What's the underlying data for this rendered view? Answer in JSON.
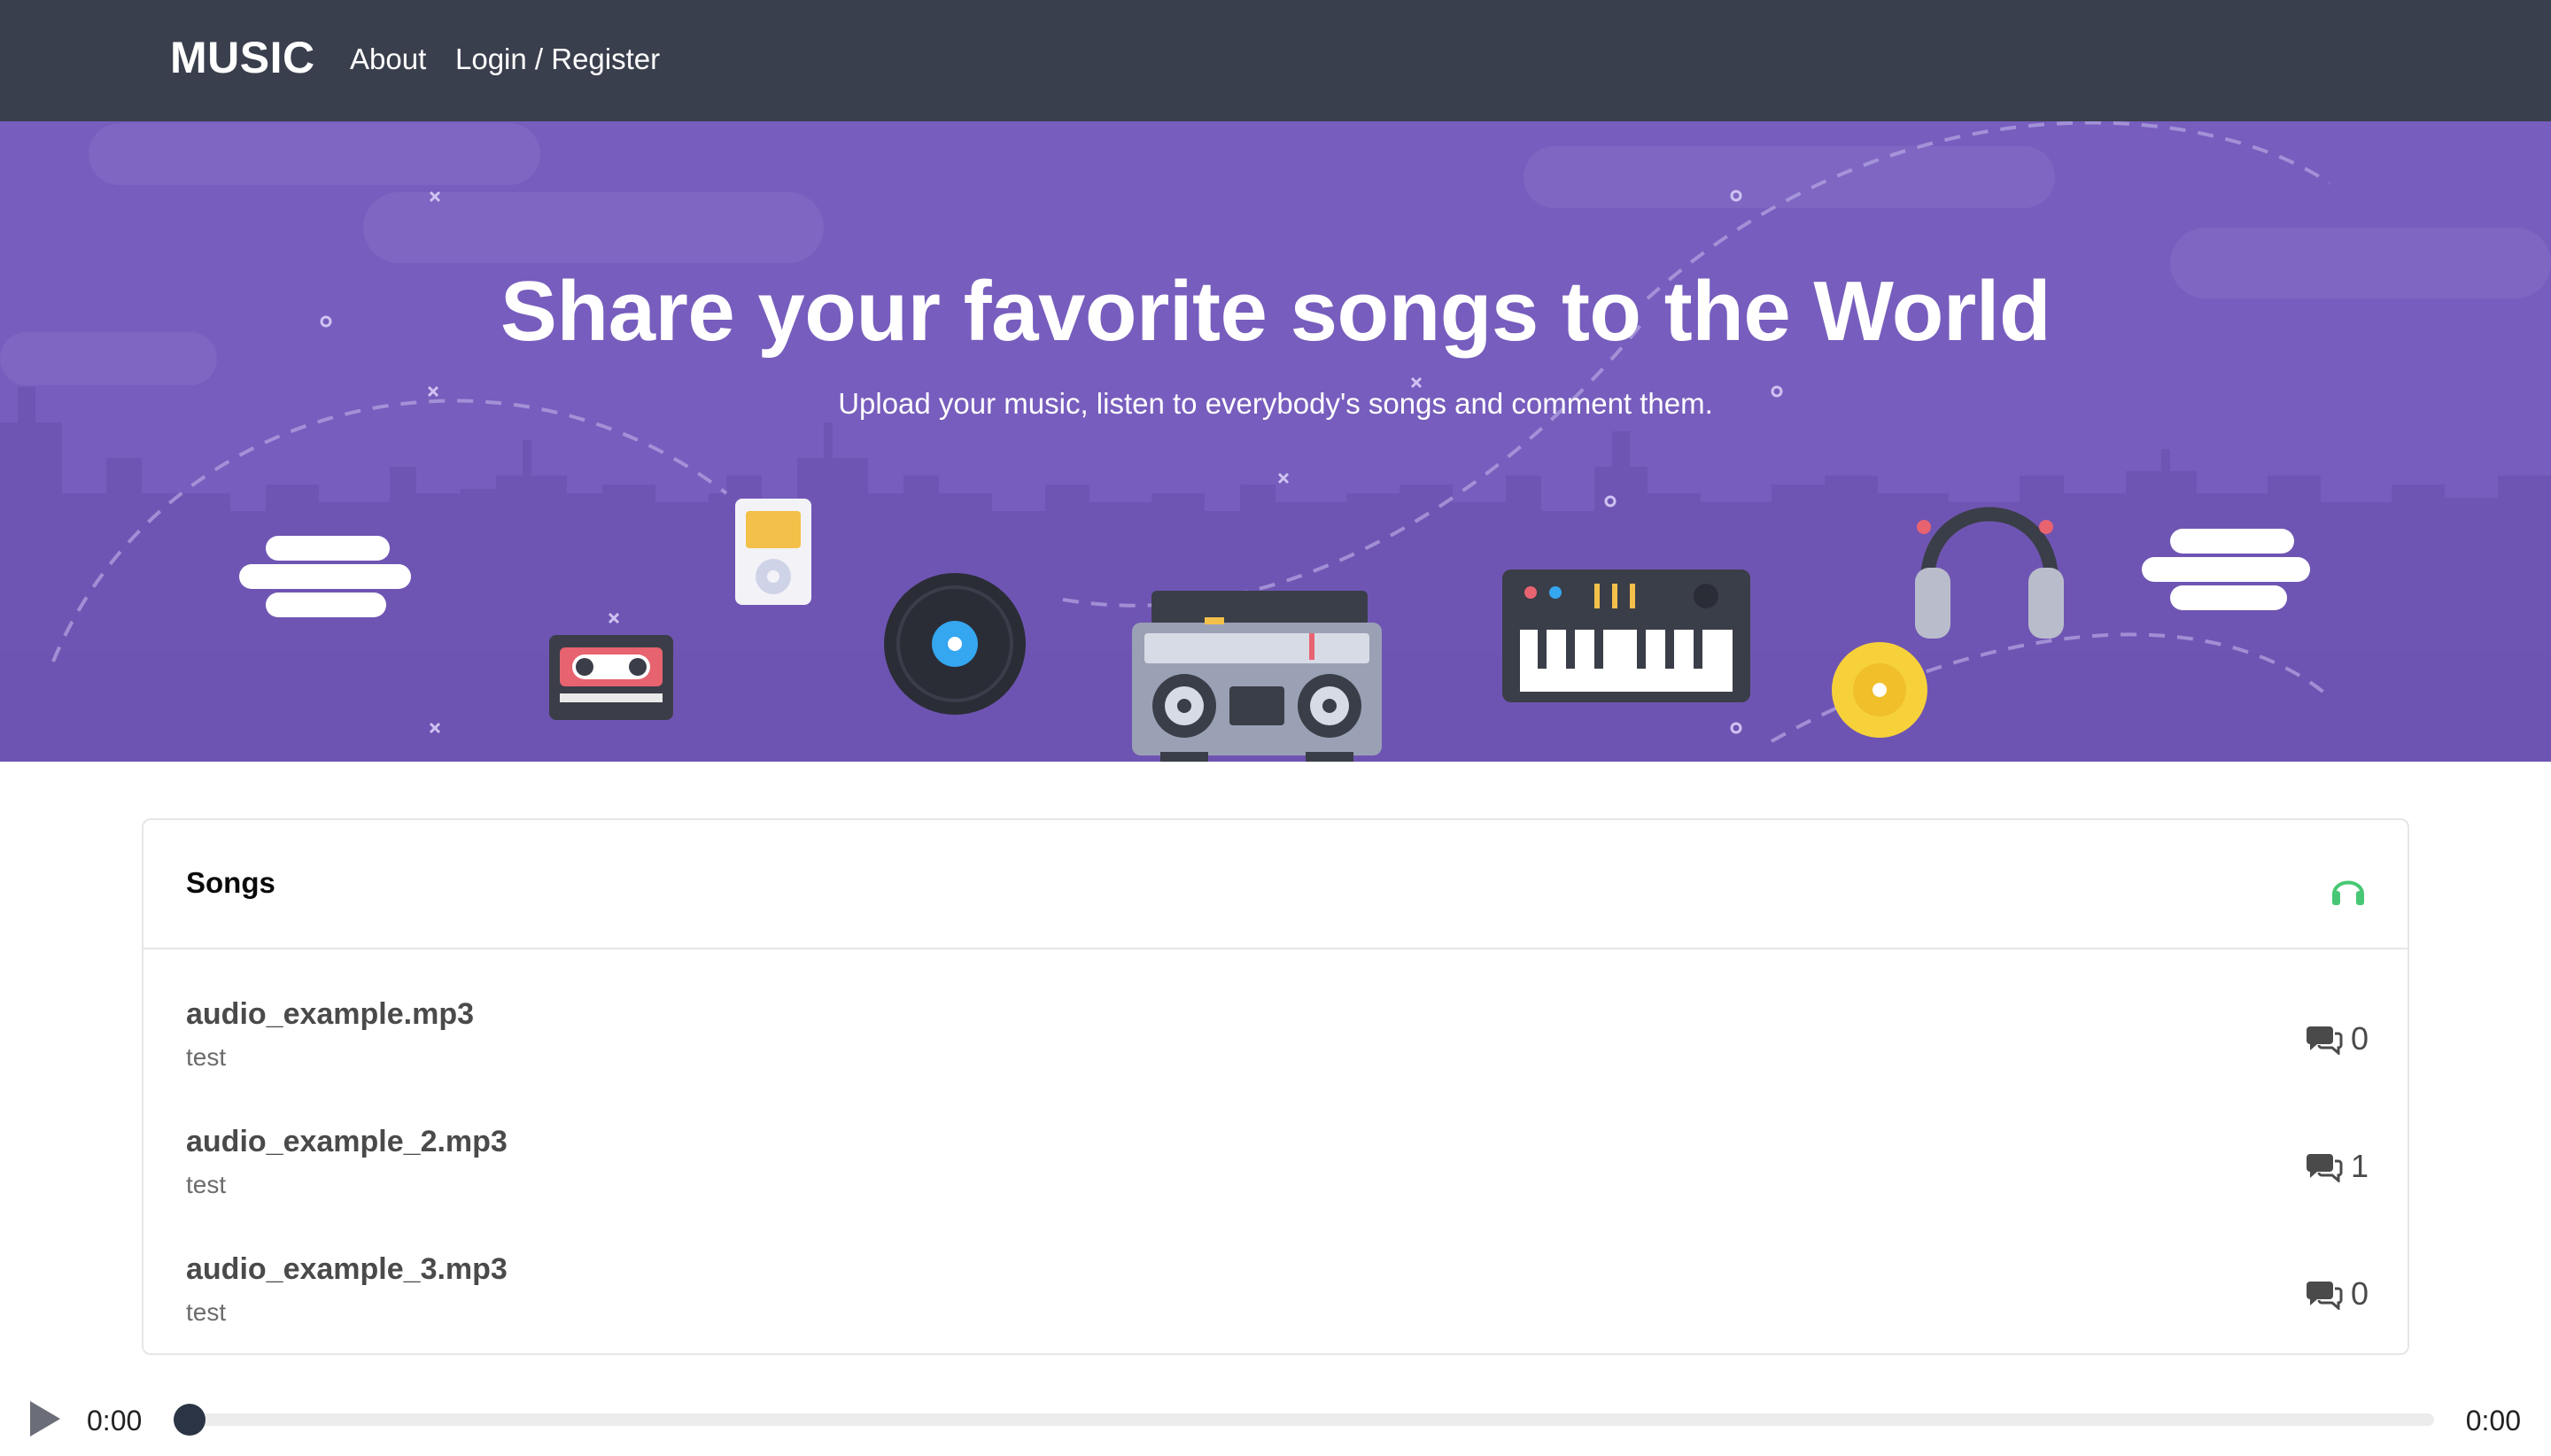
{
  "nav": {
    "brand": "MUSIC",
    "about": "About",
    "login": "Login / Register"
  },
  "hero": {
    "title": "Share your favorite songs to the World",
    "subtitle": "Upload your music, listen to everybody's songs and comment them."
  },
  "songs": {
    "header": "Songs",
    "icon": "headphones-icon",
    "items": [
      {
        "title": "audio_example.mp3",
        "user": "test",
        "comments": "0"
      },
      {
        "title": "audio_example_2.mp3",
        "user": "test",
        "comments": "1"
      },
      {
        "title": "audio_example_3.mp3",
        "user": "test",
        "comments": "0"
      }
    ]
  },
  "player": {
    "current": "0:00",
    "total": "0:00",
    "progress": 0
  },
  "colors": {
    "navbar": "#3a3f4d",
    "hero": "#775dbd",
    "accent_green": "#48c774",
    "knob": "#2b3444"
  }
}
